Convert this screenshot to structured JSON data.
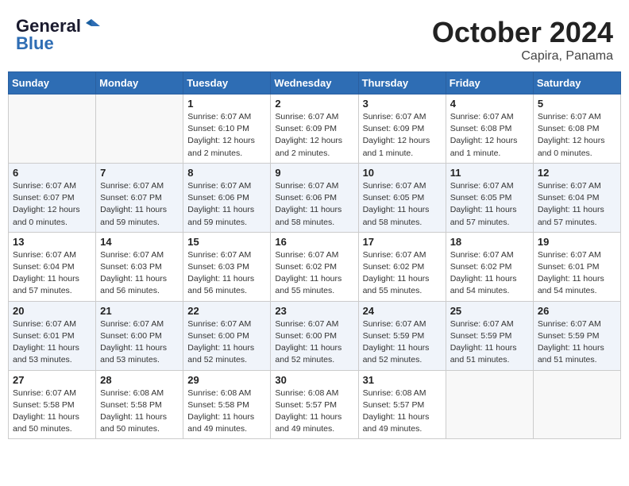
{
  "header": {
    "logo_general": "General",
    "logo_blue": "Blue",
    "month": "October 2024",
    "location": "Capira, Panama"
  },
  "days_of_week": [
    "Sunday",
    "Monday",
    "Tuesday",
    "Wednesday",
    "Thursday",
    "Friday",
    "Saturday"
  ],
  "weeks": [
    [
      {
        "day": "",
        "info": ""
      },
      {
        "day": "",
        "info": ""
      },
      {
        "day": "1",
        "info": "Sunrise: 6:07 AM\nSunset: 6:10 PM\nDaylight: 12 hours and 2 minutes."
      },
      {
        "day": "2",
        "info": "Sunrise: 6:07 AM\nSunset: 6:09 PM\nDaylight: 12 hours and 2 minutes."
      },
      {
        "day": "3",
        "info": "Sunrise: 6:07 AM\nSunset: 6:09 PM\nDaylight: 12 hours and 1 minute."
      },
      {
        "day": "4",
        "info": "Sunrise: 6:07 AM\nSunset: 6:08 PM\nDaylight: 12 hours and 1 minute."
      },
      {
        "day": "5",
        "info": "Sunrise: 6:07 AM\nSunset: 6:08 PM\nDaylight: 12 hours and 0 minutes."
      }
    ],
    [
      {
        "day": "6",
        "info": "Sunrise: 6:07 AM\nSunset: 6:07 PM\nDaylight: 12 hours and 0 minutes."
      },
      {
        "day": "7",
        "info": "Sunrise: 6:07 AM\nSunset: 6:07 PM\nDaylight: 11 hours and 59 minutes."
      },
      {
        "day": "8",
        "info": "Sunrise: 6:07 AM\nSunset: 6:06 PM\nDaylight: 11 hours and 59 minutes."
      },
      {
        "day": "9",
        "info": "Sunrise: 6:07 AM\nSunset: 6:06 PM\nDaylight: 11 hours and 58 minutes."
      },
      {
        "day": "10",
        "info": "Sunrise: 6:07 AM\nSunset: 6:05 PM\nDaylight: 11 hours and 58 minutes."
      },
      {
        "day": "11",
        "info": "Sunrise: 6:07 AM\nSunset: 6:05 PM\nDaylight: 11 hours and 57 minutes."
      },
      {
        "day": "12",
        "info": "Sunrise: 6:07 AM\nSunset: 6:04 PM\nDaylight: 11 hours and 57 minutes."
      }
    ],
    [
      {
        "day": "13",
        "info": "Sunrise: 6:07 AM\nSunset: 6:04 PM\nDaylight: 11 hours and 57 minutes."
      },
      {
        "day": "14",
        "info": "Sunrise: 6:07 AM\nSunset: 6:03 PM\nDaylight: 11 hours and 56 minutes."
      },
      {
        "day": "15",
        "info": "Sunrise: 6:07 AM\nSunset: 6:03 PM\nDaylight: 11 hours and 56 minutes."
      },
      {
        "day": "16",
        "info": "Sunrise: 6:07 AM\nSunset: 6:02 PM\nDaylight: 11 hours and 55 minutes."
      },
      {
        "day": "17",
        "info": "Sunrise: 6:07 AM\nSunset: 6:02 PM\nDaylight: 11 hours and 55 minutes."
      },
      {
        "day": "18",
        "info": "Sunrise: 6:07 AM\nSunset: 6:02 PM\nDaylight: 11 hours and 54 minutes."
      },
      {
        "day": "19",
        "info": "Sunrise: 6:07 AM\nSunset: 6:01 PM\nDaylight: 11 hours and 54 minutes."
      }
    ],
    [
      {
        "day": "20",
        "info": "Sunrise: 6:07 AM\nSunset: 6:01 PM\nDaylight: 11 hours and 53 minutes."
      },
      {
        "day": "21",
        "info": "Sunrise: 6:07 AM\nSunset: 6:00 PM\nDaylight: 11 hours and 53 minutes."
      },
      {
        "day": "22",
        "info": "Sunrise: 6:07 AM\nSunset: 6:00 PM\nDaylight: 11 hours and 52 minutes."
      },
      {
        "day": "23",
        "info": "Sunrise: 6:07 AM\nSunset: 6:00 PM\nDaylight: 11 hours and 52 minutes."
      },
      {
        "day": "24",
        "info": "Sunrise: 6:07 AM\nSunset: 5:59 PM\nDaylight: 11 hours and 52 minutes."
      },
      {
        "day": "25",
        "info": "Sunrise: 6:07 AM\nSunset: 5:59 PM\nDaylight: 11 hours and 51 minutes."
      },
      {
        "day": "26",
        "info": "Sunrise: 6:07 AM\nSunset: 5:59 PM\nDaylight: 11 hours and 51 minutes."
      }
    ],
    [
      {
        "day": "27",
        "info": "Sunrise: 6:07 AM\nSunset: 5:58 PM\nDaylight: 11 hours and 50 minutes."
      },
      {
        "day": "28",
        "info": "Sunrise: 6:08 AM\nSunset: 5:58 PM\nDaylight: 11 hours and 50 minutes."
      },
      {
        "day": "29",
        "info": "Sunrise: 6:08 AM\nSunset: 5:58 PM\nDaylight: 11 hours and 49 minutes."
      },
      {
        "day": "30",
        "info": "Sunrise: 6:08 AM\nSunset: 5:57 PM\nDaylight: 11 hours and 49 minutes."
      },
      {
        "day": "31",
        "info": "Sunrise: 6:08 AM\nSunset: 5:57 PM\nDaylight: 11 hours and 49 minutes."
      },
      {
        "day": "",
        "info": ""
      },
      {
        "day": "",
        "info": ""
      }
    ]
  ]
}
